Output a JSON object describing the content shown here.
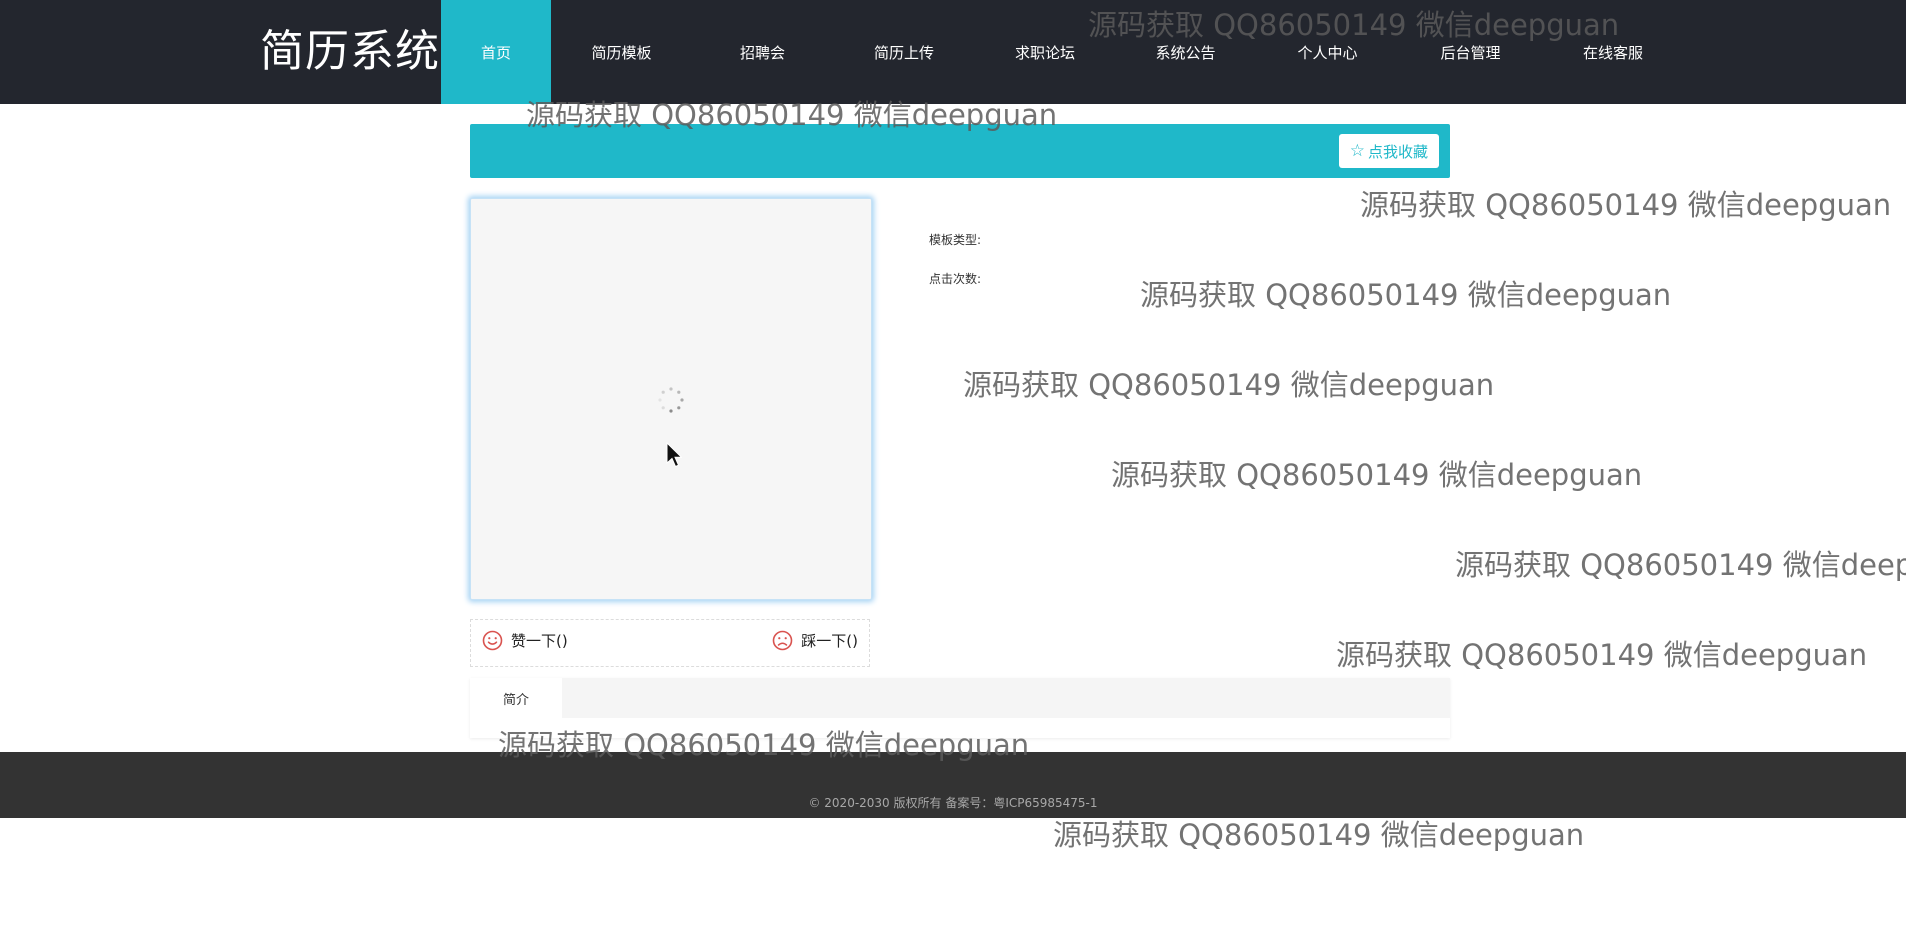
{
  "header": {
    "brand": "简历系统",
    "nav": [
      {
        "label": "首页",
        "active": true
      },
      {
        "label": "简历模板",
        "active": false
      },
      {
        "label": "招聘会",
        "active": false
      },
      {
        "label": "简历上传",
        "active": false
      },
      {
        "label": "求职论坛",
        "active": false
      },
      {
        "label": "系统公告",
        "active": false
      },
      {
        "label": "个人中心",
        "active": false
      },
      {
        "label": "后台管理",
        "active": false
      },
      {
        "label": "在线客服",
        "active": false
      }
    ]
  },
  "titlebar": {
    "favorite_label": "点我收藏",
    "favorite_icon": "star-outline-icon"
  },
  "detail": {
    "template_type_label": "模板类型:",
    "click_count_label": "点击次数:"
  },
  "vote": {
    "like_label": "赞一下()",
    "dislike_label": "踩一下()",
    "like_icon": "smile-icon",
    "dislike_icon": "frown-icon"
  },
  "tabs": [
    {
      "label": "简介"
    }
  ],
  "footer": {
    "copyright": "© 2020-2030 版权所有 备案号：粤ICP65985475-1"
  },
  "watermark": {
    "text": "源码获取 QQ86050149 微信deepguan"
  },
  "colors": {
    "header_bg": "#23262e",
    "accent": "#1fb8c9",
    "footer_bg": "#333333",
    "vote_icon": "#d9534f"
  }
}
